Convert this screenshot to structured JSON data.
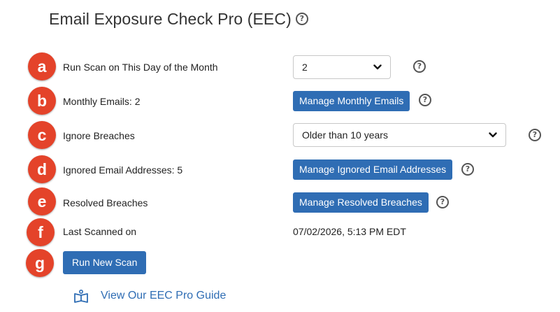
{
  "page": {
    "title": "Email Exposure Check Pro (EEC)",
    "help_glyph": "?"
  },
  "rows": [
    {
      "badge": "a",
      "label": "Run Scan on This Day of the Month",
      "control": "select",
      "value": "2"
    },
    {
      "badge": "b",
      "label": "Monthly Emails: 2",
      "control": "button",
      "value": "Manage Monthly Emails"
    },
    {
      "badge": "c",
      "label": "Ignore Breaches",
      "control": "select",
      "value": "Older than 10 years"
    },
    {
      "badge": "d",
      "label": "Ignored Email Addresses: 5",
      "control": "button",
      "value": "Manage Ignored Email Addresses"
    },
    {
      "badge": "e",
      "label": "Resolved Breaches",
      "control": "button",
      "value": "Manage Resolved Breaches"
    },
    {
      "badge": "f",
      "label": "Last Scanned on",
      "control": "text",
      "value": "07/02/2026, 5:13 PM EDT"
    },
    {
      "badge": "g",
      "label": "Run New Scan",
      "control": "primary-button"
    }
  ],
  "guide_link": {
    "label": "View Our EEC Pro Guide",
    "icon": "book-icon"
  },
  "colors": {
    "accent": "#2f6db4",
    "badge": "#e4432a"
  }
}
